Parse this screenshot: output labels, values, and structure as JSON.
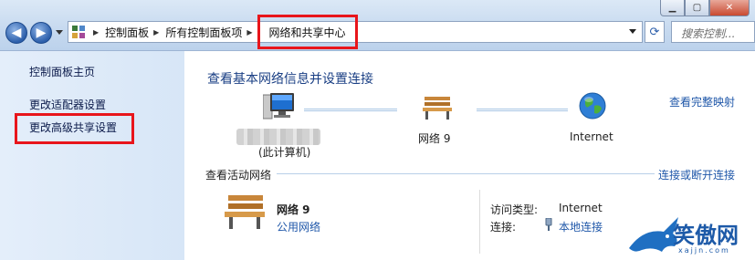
{
  "address_bar": {
    "crumbs": [
      "控制面板",
      "所有控制面板项",
      "网络和共享中心"
    ],
    "search_placeholder": "搜索控制..."
  },
  "sidebar": {
    "items": [
      {
        "label": "控制面板主页"
      },
      {
        "label": "更改适配器设置"
      },
      {
        "label": "更改高级共享设置"
      }
    ]
  },
  "main": {
    "heading": "查看基本网络信息并设置连接",
    "view_full_map": "查看完整映射",
    "map": {
      "computer_label": "(此计算机)",
      "network_label": "网络 9",
      "internet_label": "Internet"
    },
    "active_networks": {
      "title": "查看活动网络",
      "connect_link": "连接或断开连接",
      "network_name": "网络  9",
      "network_type": "公用网络",
      "access_type_label": "访问类型:",
      "access_type_value": "Internet",
      "connection_label": "连接:",
      "connection_value": "本地连接"
    }
  },
  "watermark": {
    "text": "笑傲网",
    "subtext": "xajjn.com"
  },
  "colors": {
    "highlight_red": "#e8151b",
    "link_blue": "#1f57a9",
    "heading_blue": "#1a3f84"
  }
}
